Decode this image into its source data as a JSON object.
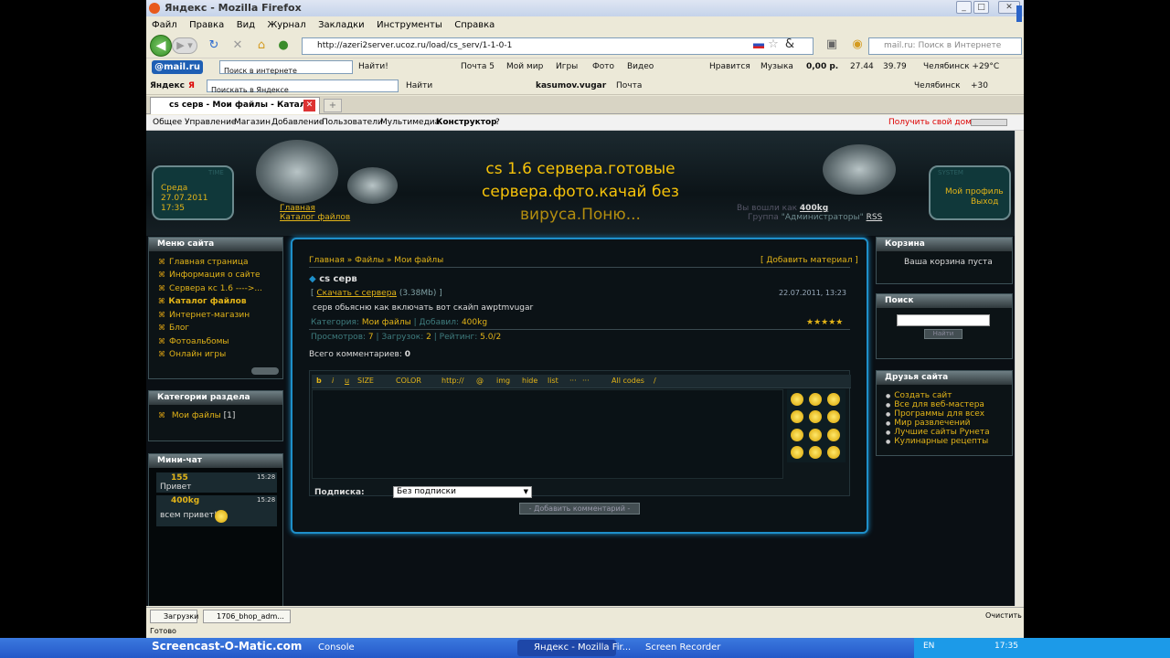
{
  "window": {
    "title": "Яндекс - Mozilla Firefox"
  },
  "menu": [
    "Файл",
    "Правка",
    "Вид",
    "Журнал",
    "Закладки",
    "Инструменты",
    "Справка"
  ],
  "nav": {
    "url": "http://azeri2server.ucoz.ru/load/cs_serv/1-1-0-1",
    "search_placeholder": "mail.ru: Поиск в Интернете"
  },
  "mailru_bar": {
    "logo": "@mail.ru",
    "search_placeholder": "Поиск в интернете",
    "find": "Найти!",
    "items": [
      "Почта 5",
      "Мой мир",
      "Игры",
      "Фото",
      "Видео",
      "Нравится",
      "Музыка",
      "0,00 р.",
      "27.44",
      "39.79",
      "Челябинск +29°C"
    ]
  },
  "yandex_bar": {
    "logo": "Яндекс",
    "search_placeholder": "Поискать в Яндексе",
    "find": "Найти",
    "user": "kasumov.vugar",
    "mail": "Почта",
    "city": "Челябинск",
    "temp": "+30"
  },
  "tab": {
    "label": "cs серв - Мои файлы - Каталог ..."
  },
  "ucoz_bar": {
    "items": [
      "Общее",
      "Управление",
      "Магазин",
      "Добавление",
      "Пользователи",
      "Мультимедиа",
      "Конструктор",
      "?"
    ],
    "domain": "Получить свой домен"
  },
  "site": {
    "title": "cs 1.6 сервера.готовые сервера.фото.качай без вируса.Поню...",
    "title_lines": [
      "cs 1.6 сервера.готовые",
      "сервера.фото.качай без",
      "вируса.Поню..."
    ],
    "date": {
      "day": "Среда",
      "date": "27.07.2011",
      "time": "17:35",
      "label_time": "TIME"
    },
    "user_panel": {
      "label": "SYSTEM",
      "profile": "Мой профиль",
      "logout": "Выход"
    },
    "breadcrumb_home": "Главная",
    "breadcrumb_catalog": "Каталог файлов",
    "logged_as": "Вы вошли как",
    "username": "400kg",
    "group_label": "Группа",
    "group": "\"Администраторы\"",
    "rss": "RSS"
  },
  "left": {
    "menu_title": "Меню сайта",
    "menu": [
      "Главная страница",
      "Информация о сайте",
      "Сервера кс 1.6 ---->...",
      "Каталог файлов",
      "Интернет-магазин",
      "Блог",
      "Фотоальбомы",
      "Онлайн игры"
    ],
    "cats_title": "Категории раздела",
    "cats": [
      {
        "name": "Мои файлы",
        "count": "[1]"
      }
    ],
    "chat_title": "Мини-чат",
    "chat": [
      {
        "user": "155",
        "time": "15:28",
        "text": "Привет"
      },
      {
        "user": "400kg",
        "time": "15:28",
        "text": "всем привет!"
      }
    ]
  },
  "main": {
    "breadcrumb": "Главная » Файлы » Мои файлы",
    "add_material": "[ Добавить материал ]",
    "file_title": "cs серв",
    "download": "Скачать с сервера",
    "size": "(3.38Mb)",
    "datetime": "22.07.2011, 13:23",
    "description": "серв обьясню как включать вот скайп awptmvugar",
    "category_label": "Категория:",
    "category": "Мои файлы",
    "added_label": "Добавил:",
    "added_by": "400kg",
    "views_label": "Просмотров:",
    "views": "7",
    "downloads_label": "Загрузок:",
    "downloads": "2",
    "rating_label": "Рейтинг:",
    "rating": "5.0/2",
    "stars": "★★★★★",
    "comments_label": "Всего комментариев:",
    "comments_count": "0",
    "editor_buttons": [
      "b",
      "i",
      "u",
      "SIZE",
      "COLOR",
      "http://",
      "@",
      "img",
      "hide",
      "list",
      "···",
      "···",
      "All codes",
      "/"
    ],
    "subscription_label": "Подписка:",
    "subscription_value": "Без подписки",
    "submit": "- Добавить комментарий -"
  },
  "right": {
    "cart_title": "Корзина",
    "cart_text": "Ваша корзина пуста",
    "search_title": "Поиск",
    "search_button": "Найти",
    "friends_title": "Друзья сайта",
    "friends": [
      "Создать сайт",
      "Все для веб-мастера",
      "Программы для всех",
      "Мир развлечений",
      "Лучшие сайты Рунета",
      "Кулинарные рецепты"
    ]
  },
  "downloads_bar": {
    "label": "Загрузки",
    "file": "1706_bhop_adm...",
    "clear": "Очистить"
  },
  "status": {
    "text": "Готово"
  },
  "taskbar": {
    "brand": "Screencast-O-Matic.com",
    "items": [
      "Console",
      "Яндекс - Mozilla Fir...",
      "Screen Recorder"
    ],
    "lang": "EN",
    "clock": "17:35"
  }
}
